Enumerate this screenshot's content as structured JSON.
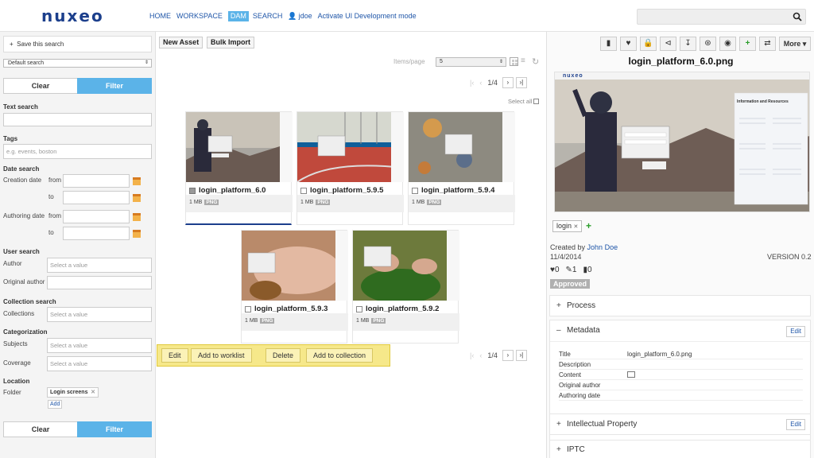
{
  "header": {
    "logo": "nuxeo",
    "nav": [
      "HOME",
      "WORKSPACE",
      "DAM",
      "SEARCH"
    ],
    "user": "jdoe",
    "dev_mode": "Activate UI Development mode",
    "search_placeholder": ""
  },
  "left_panel": {
    "save_search": "Save this search",
    "saved_search_select": "Default search",
    "clear_label": "Clear",
    "filter_label": "Filter",
    "text_search": "Text search",
    "tags": "Tags",
    "tags_placeholder": "e.g. events, boston",
    "date_search": "Date search",
    "creation_date": "Creation date",
    "authoring_date": "Authoring date",
    "from": "from",
    "to": "to",
    "user_search": "User search",
    "author": "Author",
    "original_author": "Original author",
    "select_placeholder": "Select a value",
    "collection_search": "Collection search",
    "collections": "Collections",
    "categorization": "Categorization",
    "subjects": "Subjects",
    "coverage": "Coverage",
    "location": "Location",
    "folder": "Folder",
    "folder_tag": "Login screens",
    "add": "Add"
  },
  "toolbar": {
    "new_asset": "New Asset",
    "bulk_import": "Bulk Import",
    "items_per_page_label": "Items/page",
    "items_per_page_value": "5",
    "pager_text": "1/4",
    "select_all": "Select all"
  },
  "assets": [
    {
      "name": "login_platform_6.0",
      "size": "1 MB",
      "type": "PNG",
      "checked": true
    },
    {
      "name": "login_platform_5.9.5",
      "size": "1 MB",
      "type": "PNG",
      "checked": false
    },
    {
      "name": "login_platform_5.9.4",
      "size": "1 MB",
      "type": "PNG",
      "checked": false
    },
    {
      "name": "login_platform_5.9.3",
      "size": "1 MB",
      "type": "PNG",
      "checked": false
    },
    {
      "name": "login_platform_5.9.2",
      "size": "1 MB",
      "type": "PNG",
      "checked": false
    }
  ],
  "action_bar": {
    "edit": "Edit",
    "add_worklist": "Add to worklist",
    "delete": "Delete",
    "add_collection": "Add to collection"
  },
  "detail": {
    "more": "More",
    "title": "login_platform_6.0.png",
    "preview_brand": "nuxeo",
    "preview_heading": "Information and Resources",
    "tag": "login",
    "created_by_label": "Created by",
    "created_by": "John Doe",
    "date": "11/4/2014",
    "version": "VERSION 0.2",
    "likes": "0",
    "edits": "1",
    "comments": "0",
    "status": "Approved",
    "sections": {
      "process": "Process",
      "metadata": "Metadata",
      "ip": "Intellectual Property",
      "iptc": "IPTC"
    },
    "edit_label": "Edit",
    "metadata": {
      "title_k": "Title",
      "title_v": "login_platform_6.0.png",
      "description_k": "Description",
      "content_k": "Content",
      "original_author_k": "Original author",
      "authoring_date_k": "Authoring date"
    }
  },
  "colors": {
    "accent": "#5bb3e8",
    "brand": "#1c3f8c",
    "link": "#1f56a8",
    "actionbar": "#f6e88a"
  }
}
